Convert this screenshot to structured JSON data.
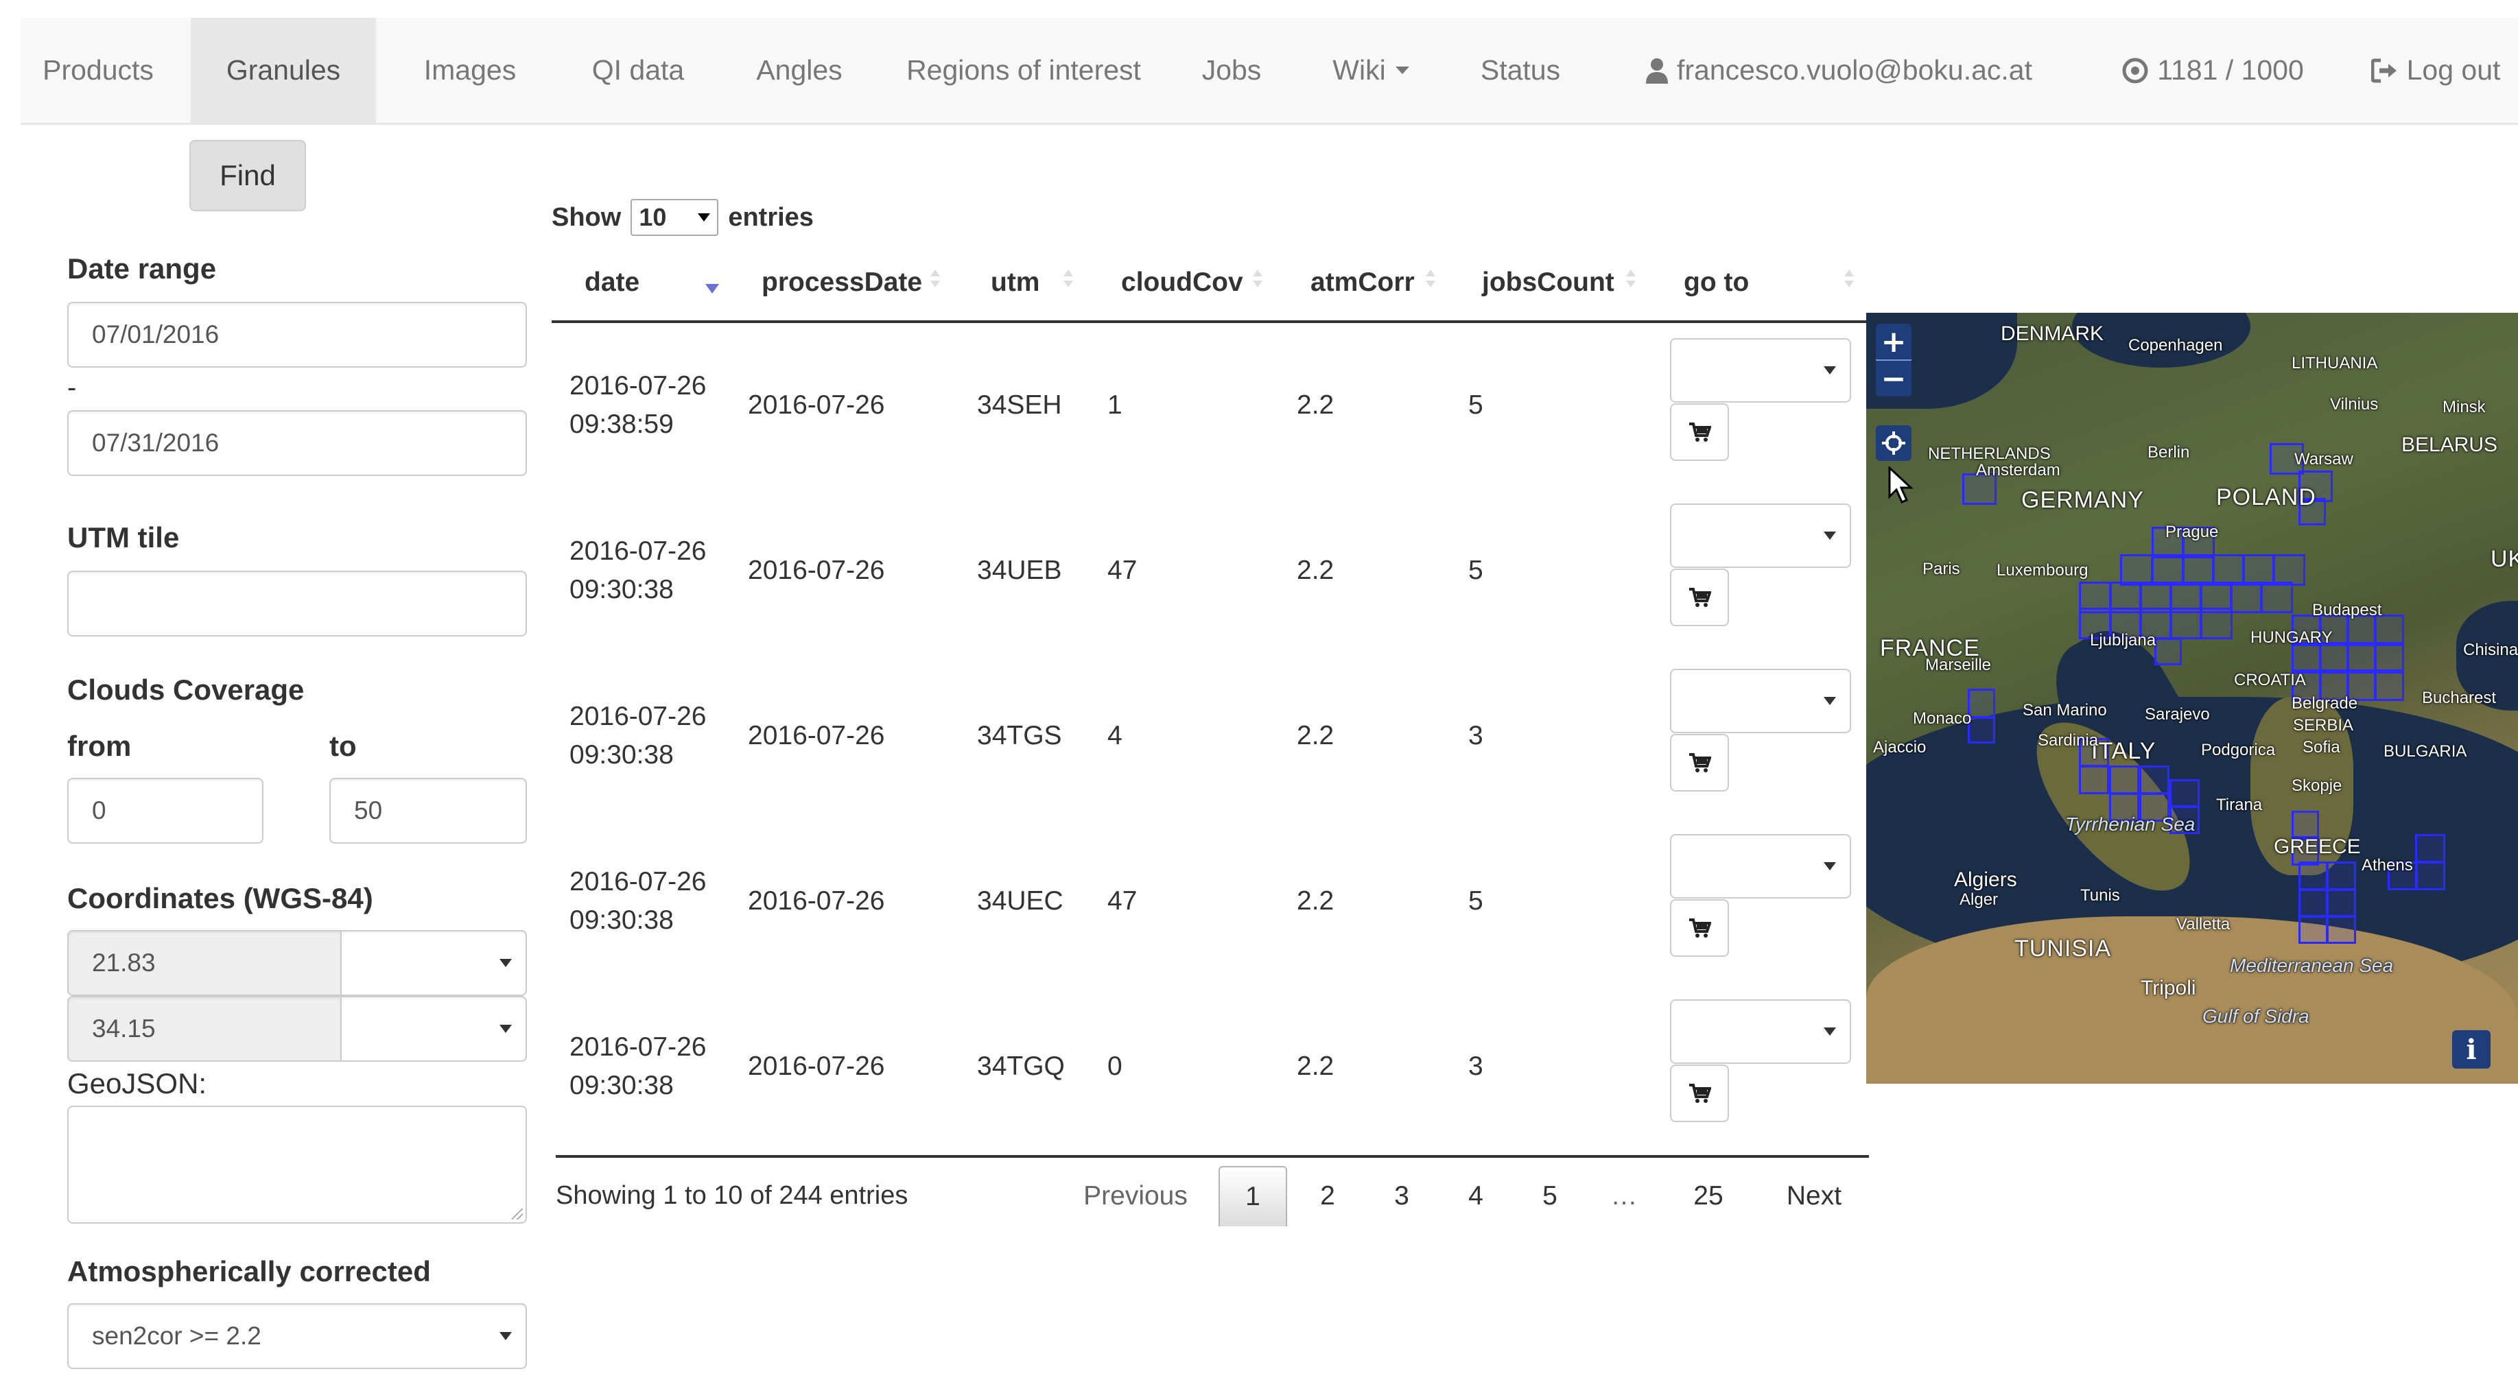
{
  "navbar": {
    "items": [
      {
        "label": "Products"
      },
      {
        "label": "Granules"
      },
      {
        "label": "Images"
      },
      {
        "label": "QI data"
      },
      {
        "label": "Angles"
      },
      {
        "label": "Regions of interest"
      },
      {
        "label": "Jobs"
      },
      {
        "label": "Wiki"
      },
      {
        "label": "Status"
      }
    ],
    "active": "Granules",
    "user_email": "francesco.vuolo@boku.ac.at",
    "quota": "1181 / 1000",
    "logout": "Log out"
  },
  "filters": {
    "find_label": "Find",
    "date_range_label": "Date range",
    "date_from": "07/01/2016",
    "date_separator": "-",
    "date_to": "07/31/2016",
    "utm_label": "UTM tile",
    "utm_value": "",
    "clouds_label": "Clouds Coverage",
    "clouds_from_label": "from",
    "clouds_to_label": "to",
    "clouds_from": "0",
    "clouds_to": "50",
    "coords_label": "Coordinates (WGS-84)",
    "lon": "21.83",
    "lat": "34.15",
    "geojson_label": "GeoJSON:",
    "atm_label": "Atmospherically corrected",
    "atm_value": "sen2cor >= 2.2"
  },
  "table": {
    "show_label": "Show",
    "page_length": "10",
    "entries_label": "entries",
    "columns": [
      "date",
      "processDate",
      "utm",
      "cloudCov",
      "atmCorr",
      "jobsCount",
      "go to"
    ],
    "rows": [
      {
        "date": "2016-07-26",
        "time": "09:38:59",
        "processDate": "2016-07-26",
        "utm": "34SEH",
        "cloudCov": "1",
        "atmCorr": "2.2",
        "jobsCount": "5"
      },
      {
        "date": "2016-07-26",
        "time": "09:30:38",
        "processDate": "2016-07-26",
        "utm": "34UEB",
        "cloudCov": "47",
        "atmCorr": "2.2",
        "jobsCount": "5"
      },
      {
        "date": "2016-07-26",
        "time": "09:30:38",
        "processDate": "2016-07-26",
        "utm": "34TGS",
        "cloudCov": "4",
        "atmCorr": "2.2",
        "jobsCount": "3"
      },
      {
        "date": "2016-07-26",
        "time": "09:30:38",
        "processDate": "2016-07-26",
        "utm": "34UEC",
        "cloudCov": "47",
        "atmCorr": "2.2",
        "jobsCount": "5"
      },
      {
        "date": "2016-07-26",
        "time": "09:30:38",
        "processDate": "2016-07-26",
        "utm": "34TGQ",
        "cloudCov": "0",
        "atmCorr": "2.2",
        "jobsCount": "3"
      }
    ],
    "info": "Showing 1 to 10 of 244 entries",
    "pagination": {
      "previous": "Previous",
      "pages": [
        "1",
        "2",
        "3",
        "4",
        "5",
        "…",
        "25"
      ],
      "current": "1",
      "next": "Next"
    }
  },
  "map": {
    "zoom_in": "+",
    "zoom_out": "−",
    "info": "i",
    "labels": [
      {
        "text": "DENMARK"
      },
      {
        "text": "Copenhagen"
      },
      {
        "text": "LITHUANIA"
      },
      {
        "text": "Vilnius"
      },
      {
        "text": "Minsk"
      },
      {
        "text": "BELARUS"
      },
      {
        "text": "NETHERLANDS"
      },
      {
        "text": "Amsterdam"
      },
      {
        "text": "Berlin"
      },
      {
        "text": "Warsaw"
      },
      {
        "text": "GERMANY"
      },
      {
        "text": "POLAND"
      },
      {
        "text": "Prague"
      },
      {
        "text": "Paris"
      },
      {
        "text": "Luxembourg"
      },
      {
        "text": "UKR"
      },
      {
        "text": "FRANCE"
      },
      {
        "text": "Ljubljana"
      },
      {
        "text": "Budapest"
      },
      {
        "text": "HUNGARY"
      },
      {
        "text": "Chisinau"
      },
      {
        "text": "Monaco"
      },
      {
        "text": "San Marino"
      },
      {
        "text": "CROATIA"
      },
      {
        "text": "Sarajevo"
      },
      {
        "text": "Belgrade"
      },
      {
        "text": "SERBIA"
      },
      {
        "text": "Bucharest"
      },
      {
        "text": "ITALY"
      },
      {
        "text": "Podgorica"
      },
      {
        "text": "Sofia"
      },
      {
        "text": "BULGARIA"
      },
      {
        "text": "Skopje"
      },
      {
        "text": "Tirana"
      },
      {
        "text": "Tyrrhenian Sea"
      },
      {
        "text": "GREECE"
      },
      {
        "text": "Athens"
      },
      {
        "text": "Algiers"
      },
      {
        "text": "Alger"
      },
      {
        "text": "Tunis"
      },
      {
        "text": "Valletta"
      },
      {
        "text": "TUNISIA"
      },
      {
        "text": "Mediterranean Sea"
      },
      {
        "text": "Tripoli"
      },
      {
        "text": "Gulf of Sidra"
      },
      {
        "text": "Marseille"
      },
      {
        "text": "Ajaccio"
      },
      {
        "text": "Sardinia"
      }
    ],
    "overlay_color": "#2a2aff"
  },
  "colors": {
    "navbar_bg": "#f8f8f8",
    "navbar_active": "#e7e7e7",
    "sort_active": "#6a72d8",
    "map_control": "#1f3d7a"
  }
}
